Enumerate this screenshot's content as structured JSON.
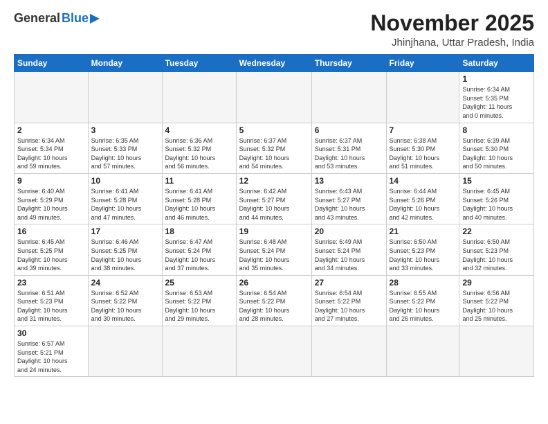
{
  "header": {
    "logo_general": "General",
    "logo_blue": "Blue",
    "month_title": "November 2025",
    "location": "Jhinjhana, Uttar Pradesh, India"
  },
  "weekdays": [
    "Sunday",
    "Monday",
    "Tuesday",
    "Wednesday",
    "Thursday",
    "Friday",
    "Saturday"
  ],
  "weeks": [
    [
      {
        "day": "",
        "info": ""
      },
      {
        "day": "",
        "info": ""
      },
      {
        "day": "",
        "info": ""
      },
      {
        "day": "",
        "info": ""
      },
      {
        "day": "",
        "info": ""
      },
      {
        "day": "",
        "info": ""
      },
      {
        "day": "1",
        "info": "Sunrise: 6:34 AM\nSunset: 5:35 PM\nDaylight: 11 hours\nand 0 minutes."
      }
    ],
    [
      {
        "day": "2",
        "info": "Sunrise: 6:34 AM\nSunset: 5:34 PM\nDaylight: 10 hours\nand 59 minutes."
      },
      {
        "day": "3",
        "info": "Sunrise: 6:35 AM\nSunset: 5:33 PM\nDaylight: 10 hours\nand 57 minutes."
      },
      {
        "day": "4",
        "info": "Sunrise: 6:36 AM\nSunset: 5:32 PM\nDaylight: 10 hours\nand 56 minutes."
      },
      {
        "day": "5",
        "info": "Sunrise: 6:37 AM\nSunset: 5:32 PM\nDaylight: 10 hours\nand 54 minutes."
      },
      {
        "day": "6",
        "info": "Sunrise: 6:37 AM\nSunset: 5:31 PM\nDaylight: 10 hours\nand 53 minutes."
      },
      {
        "day": "7",
        "info": "Sunrise: 6:38 AM\nSunset: 5:30 PM\nDaylight: 10 hours\nand 51 minutes."
      },
      {
        "day": "8",
        "info": "Sunrise: 6:39 AM\nSunset: 5:30 PM\nDaylight: 10 hours\nand 50 minutes."
      }
    ],
    [
      {
        "day": "9",
        "info": "Sunrise: 6:40 AM\nSunset: 5:29 PM\nDaylight: 10 hours\nand 49 minutes."
      },
      {
        "day": "10",
        "info": "Sunrise: 6:41 AM\nSunset: 5:28 PM\nDaylight: 10 hours\nand 47 minutes."
      },
      {
        "day": "11",
        "info": "Sunrise: 6:41 AM\nSunset: 5:28 PM\nDaylight: 10 hours\nand 46 minutes."
      },
      {
        "day": "12",
        "info": "Sunrise: 6:42 AM\nSunset: 5:27 PM\nDaylight: 10 hours\nand 44 minutes."
      },
      {
        "day": "13",
        "info": "Sunrise: 6:43 AM\nSunset: 5:27 PM\nDaylight: 10 hours\nand 43 minutes."
      },
      {
        "day": "14",
        "info": "Sunrise: 6:44 AM\nSunset: 5:26 PM\nDaylight: 10 hours\nand 42 minutes."
      },
      {
        "day": "15",
        "info": "Sunrise: 6:45 AM\nSunset: 5:26 PM\nDaylight: 10 hours\nand 40 minutes."
      }
    ],
    [
      {
        "day": "16",
        "info": "Sunrise: 6:45 AM\nSunset: 5:25 PM\nDaylight: 10 hours\nand 39 minutes."
      },
      {
        "day": "17",
        "info": "Sunrise: 6:46 AM\nSunset: 5:25 PM\nDaylight: 10 hours\nand 38 minutes."
      },
      {
        "day": "18",
        "info": "Sunrise: 6:47 AM\nSunset: 5:24 PM\nDaylight: 10 hours\nand 37 minutes."
      },
      {
        "day": "19",
        "info": "Sunrise: 6:48 AM\nSunset: 5:24 PM\nDaylight: 10 hours\nand 35 minutes."
      },
      {
        "day": "20",
        "info": "Sunrise: 6:49 AM\nSunset: 5:24 PM\nDaylight: 10 hours\nand 34 minutes."
      },
      {
        "day": "21",
        "info": "Sunrise: 6:50 AM\nSunset: 5:23 PM\nDaylight: 10 hours\nand 33 minutes."
      },
      {
        "day": "22",
        "info": "Sunrise: 6:50 AM\nSunset: 5:23 PM\nDaylight: 10 hours\nand 32 minutes."
      }
    ],
    [
      {
        "day": "23",
        "info": "Sunrise: 6:51 AM\nSunset: 5:23 PM\nDaylight: 10 hours\nand 31 minutes."
      },
      {
        "day": "24",
        "info": "Sunrise: 6:52 AM\nSunset: 5:22 PM\nDaylight: 10 hours\nand 30 minutes."
      },
      {
        "day": "25",
        "info": "Sunrise: 6:53 AM\nSunset: 5:22 PM\nDaylight: 10 hours\nand 29 minutes."
      },
      {
        "day": "26",
        "info": "Sunrise: 6:54 AM\nSunset: 5:22 PM\nDaylight: 10 hours\nand 28 minutes."
      },
      {
        "day": "27",
        "info": "Sunrise: 6:54 AM\nSunset: 5:22 PM\nDaylight: 10 hours\nand 27 minutes."
      },
      {
        "day": "28",
        "info": "Sunrise: 6:55 AM\nSunset: 5:22 PM\nDaylight: 10 hours\nand 26 minutes."
      },
      {
        "day": "29",
        "info": "Sunrise: 6:56 AM\nSunset: 5:22 PM\nDaylight: 10 hours\nand 25 minutes."
      }
    ],
    [
      {
        "day": "30",
        "info": "Sunrise: 6:57 AM\nSunset: 5:21 PM\nDaylight: 10 hours\nand 24 minutes."
      },
      {
        "day": "",
        "info": ""
      },
      {
        "day": "",
        "info": ""
      },
      {
        "day": "",
        "info": ""
      },
      {
        "day": "",
        "info": ""
      },
      {
        "day": "",
        "info": ""
      },
      {
        "day": "",
        "info": ""
      }
    ]
  ]
}
